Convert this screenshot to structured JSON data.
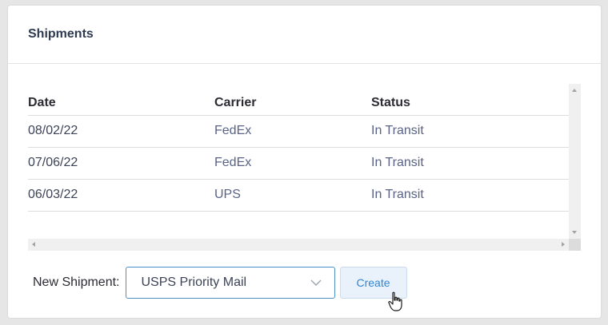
{
  "panel": {
    "title": "Shipments"
  },
  "table": {
    "columns": [
      "Date",
      "Carrier",
      "Status"
    ],
    "rows": [
      {
        "date": "08/02/22",
        "carrier": "FedEx",
        "status": "In Transit"
      },
      {
        "date": "07/06/22",
        "carrier": "FedEx",
        "status": "In Transit"
      },
      {
        "date": "06/03/22",
        "carrier": "UPS",
        "status": "In Transit"
      }
    ]
  },
  "new_shipment": {
    "label": "New Shipment:",
    "selected_option": "USPS Priority Mail",
    "create_label": "Create"
  },
  "icons": {
    "dropdown": "chevron-down-icon",
    "cursor": "hand-pointer-icon"
  },
  "colors": {
    "accent": "#2e86d6",
    "select_border": "#4a90c6",
    "button_bg": "#e9f1fb"
  }
}
